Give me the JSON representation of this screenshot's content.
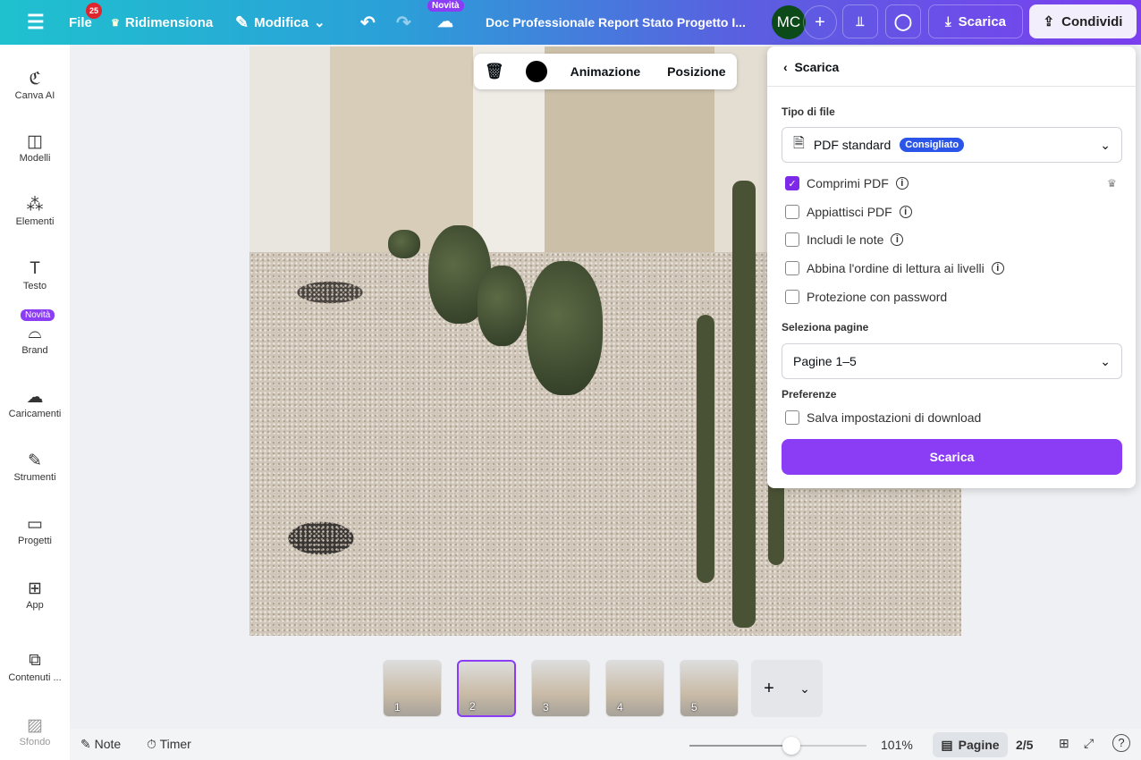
{
  "topbar": {
    "file": "File",
    "file_badge": "25",
    "resize": "Ridimensiona",
    "edit": "Modifica",
    "new_badge": "Novità",
    "title": "Doc Professionale Report Stato Progetto I...",
    "avatar": "MC",
    "download": "Scarica",
    "share": "Condividi"
  },
  "sidebar": [
    {
      "label": "Canva AI",
      "icon": "canva-ai-icon",
      "glyph": "ℭ"
    },
    {
      "label": "Modelli",
      "icon": "templates-icon",
      "glyph": "◫"
    },
    {
      "label": "Elementi",
      "icon": "elements-icon",
      "glyph": "⁂"
    },
    {
      "label": "Testo",
      "icon": "text-icon",
      "glyph": "T"
    },
    {
      "label": "Brand",
      "icon": "brand-icon",
      "glyph": "⌓"
    },
    {
      "label": "Caricamenti",
      "icon": "upload-icon",
      "glyph": "☁"
    },
    {
      "label": "Strumenti",
      "icon": "tools-icon",
      "glyph": "✎"
    },
    {
      "label": "Progetti",
      "icon": "folder-icon",
      "glyph": "▭"
    },
    {
      "label": "App",
      "icon": "apps-icon",
      "glyph": "⊞"
    },
    {
      "label": "Contenuti ...",
      "icon": "magic-media-icon",
      "glyph": "⧉"
    },
    {
      "label": "Sfondo",
      "icon": "background-icon",
      "glyph": "▨"
    }
  ],
  "sidebar_brand_badge": "Novità",
  "float_toolbar": {
    "animation": "Animazione",
    "position": "Posizione"
  },
  "panel": {
    "back_title": "Scarica",
    "file_type_label": "Tipo di file",
    "file_type": "PDF standard",
    "recommended": "Consigliato",
    "options": [
      {
        "label": "Comprimi PDF",
        "checked": true,
        "info": true
      },
      {
        "label": "Appiattisci PDF",
        "checked": false,
        "info": true
      },
      {
        "label": "Includi le note",
        "checked": false,
        "info": true
      },
      {
        "label": "Abbina l'ordine di lettura ai livelli",
        "checked": false,
        "info": true
      },
      {
        "label": "Protezione con password",
        "checked": false,
        "info": false
      }
    ],
    "pages_label": "Seleziona pagine",
    "pages_value": "Pagine 1–5",
    "prefs_label": "Preferenze",
    "save_settings": "Salva impostazioni di download",
    "download_button": "Scarica"
  },
  "pages": [
    "1",
    "2",
    "3",
    "4",
    "5"
  ],
  "current_page_index": 1,
  "bottom": {
    "notes": "Note",
    "timer": "Timer",
    "zoom": "101%",
    "zoom_value": 101,
    "pages": "Pagine",
    "page_count": "2/5"
  }
}
